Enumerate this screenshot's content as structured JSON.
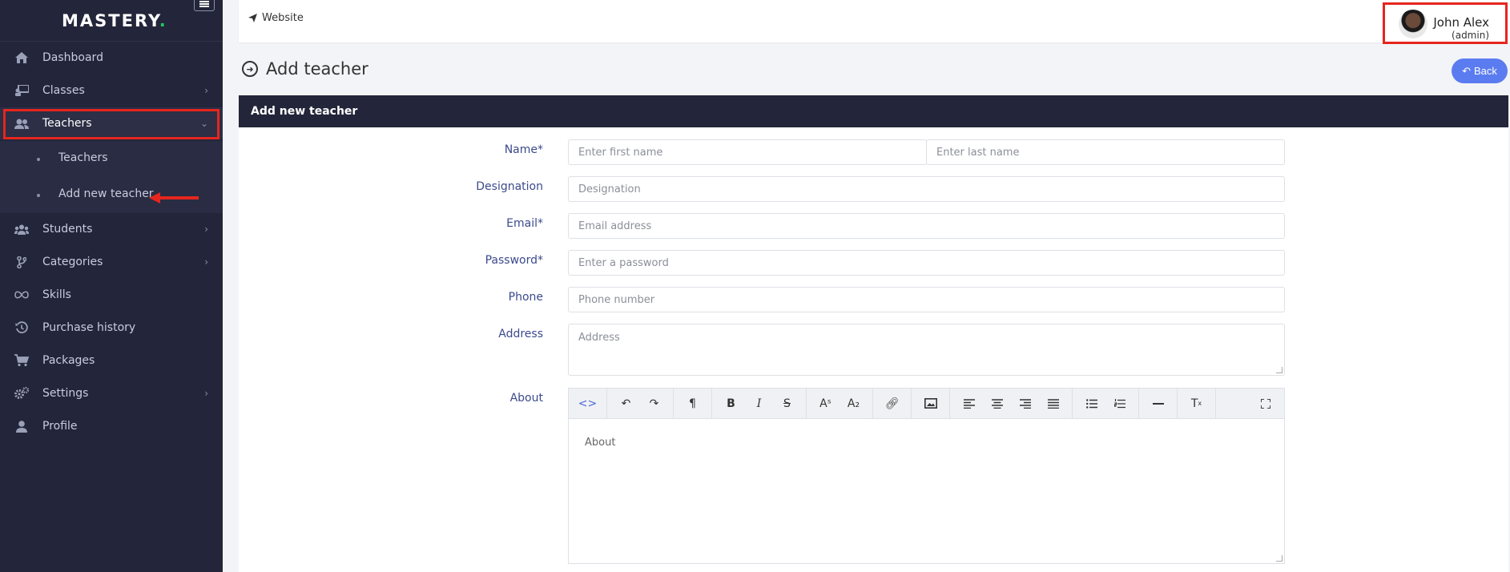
{
  "brand": {
    "name": "MASTERY",
    "dot": "."
  },
  "sidebar": {
    "items": [
      {
        "label": "Dashboard"
      },
      {
        "label": "Classes"
      },
      {
        "label": "Teachers"
      },
      {
        "label": "Students"
      },
      {
        "label": "Categories"
      },
      {
        "label": "Skills"
      },
      {
        "label": "Purchase history"
      },
      {
        "label": "Packages"
      },
      {
        "label": "Settings"
      },
      {
        "label": "Profile"
      }
    ],
    "sub_items": [
      {
        "label": "Teachers"
      },
      {
        "label": "Add new teacher"
      }
    ]
  },
  "topbar": {
    "website_label": "Website",
    "user_name": "John Alex",
    "user_role": "(admin)"
  },
  "page": {
    "title": "Add teacher",
    "back_label": "Back"
  },
  "card": {
    "title": "Add new teacher"
  },
  "form": {
    "name_label": "Name*",
    "first_name_placeholder": "Enter first name",
    "last_name_placeholder": "Enter last name",
    "designation_label": "Designation",
    "designation_placeholder": "Designation",
    "email_label": "Email*",
    "email_placeholder": "Email address",
    "password_label": "Password*",
    "password_placeholder": "Enter a password",
    "phone_label": "Phone",
    "phone_placeholder": "Phone number",
    "address_label": "Address",
    "address_placeholder": "Address",
    "about_label": "About",
    "about_placeholder": "About"
  },
  "colors": {
    "sidebar_bg": "#23263a",
    "highlight": "#e5261e",
    "back_button": "#5b7cf0",
    "label": "#3b4a8c",
    "logo_dot": "#22c55e"
  }
}
